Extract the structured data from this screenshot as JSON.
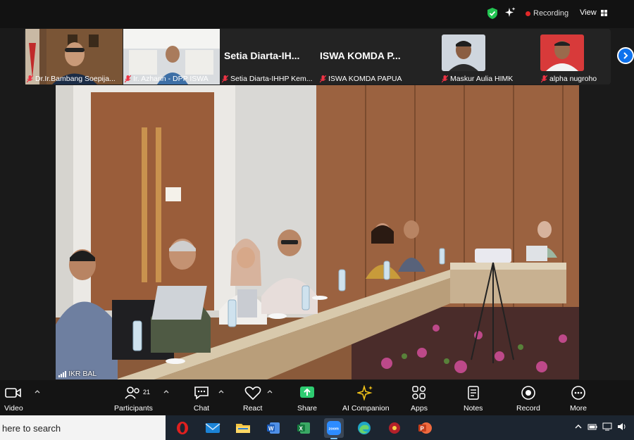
{
  "top_bar": {
    "recording_label": "Recording",
    "view_label": "View",
    "recording_color": "#e02828"
  },
  "participants_strip": {
    "tiles": [
      {
        "name": "Dr.Ir.Bambang Soepija..."
      },
      {
        "name": "Ir. Azharin - DPP ISWA"
      },
      {
        "name": "Setia Diarta-IHHP Kem...",
        "display_name": "Setia  Diarta-IH..."
      },
      {
        "name": "ISWA KOMDA PAPUA",
        "display_name": "ISWA  KOMDA  P..."
      },
      {
        "name": "Maskur Aulia HIMKI"
      },
      {
        "name": "alpha nugroho"
      }
    ],
    "next_icon": "chevron-right-icon"
  },
  "main_video": {
    "speaker_label": "IKR BAL"
  },
  "controls": {
    "video_label": "Video",
    "participants_label": "Participants",
    "participants_count": "21",
    "chat_label": "Chat",
    "react_label": "React",
    "share_label": "Share",
    "ai_companion_label": "AI Companion",
    "apps_label": "Apps",
    "notes_label": "Notes",
    "record_label": "Record",
    "more_label": "More",
    "share_color": "#2ecc71",
    "ai_color": "#f5c518"
  },
  "taskbar": {
    "search_text": "here to search",
    "apps": [
      "opera-icon",
      "mail-icon",
      "file-explorer-icon",
      "word-icon",
      "excel-icon",
      "zoom-icon",
      "edge-icon",
      "app-icon",
      "powerpoint-icon"
    ]
  }
}
